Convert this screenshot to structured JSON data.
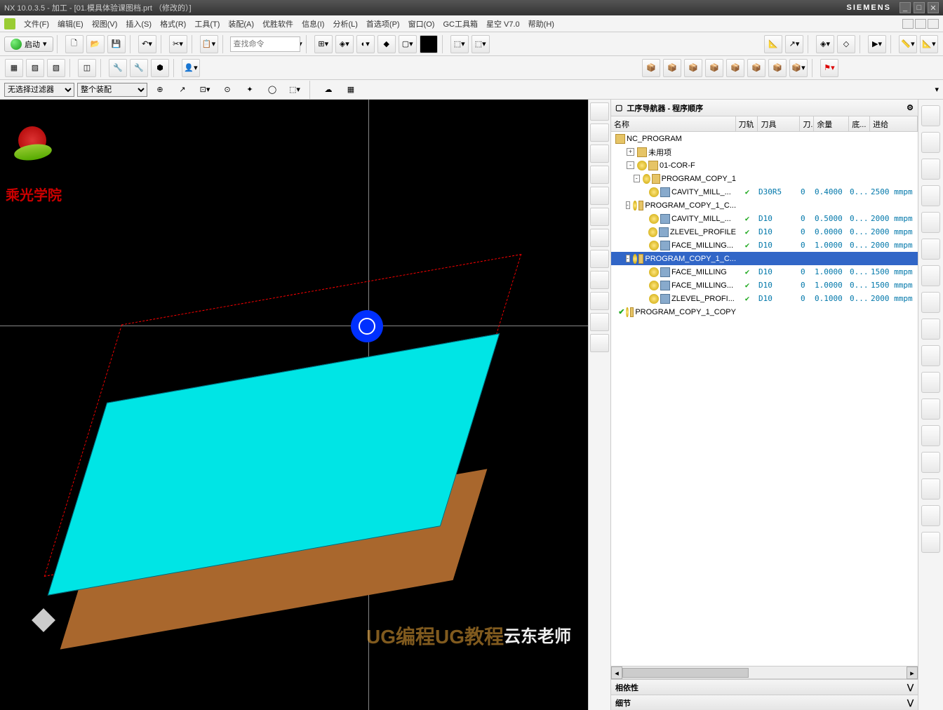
{
  "title": "NX 10.0.3.5 - 加工 - [01.模具体验课图档.prt （修改的）]",
  "brand": "SIEMENS",
  "menus": [
    "文件(F)",
    "编辑(E)",
    "视图(V)",
    "插入(S)",
    "格式(R)",
    "工具(T)",
    "装配(A)",
    "优胜软件",
    "信息(I)",
    "分析(L)",
    "首选项(P)",
    "窗口(O)",
    "GC工具箱",
    "星空 V7.0",
    "帮助(H)"
  ],
  "start": "启动",
  "search_placeholder": "查找命令",
  "filter1": "无选择过滤器",
  "filter2": "整个装配",
  "logo_cn": "乘光学院",
  "watermark1": "云东老师",
  "watermark2": "UG编程UG教程",
  "panel_title": "工序导航器 - 程序顺序",
  "columns": {
    "name": "名称",
    "track": "刀轨",
    "tool": "刀具",
    "knife": "刀...",
    "remain": "余量",
    "bottom": "底...",
    "feed": "进给"
  },
  "footer": {
    "deps": "相依性",
    "detail": "细节"
  },
  "tree": [
    {
      "d": 0,
      "t": "root",
      "label": "NC_PROGRAM"
    },
    {
      "d": 1,
      "t": "folder",
      "exp": "+",
      "label": "未用项"
    },
    {
      "d": 1,
      "t": "folder",
      "exp": "-",
      "bulb": true,
      "label": "01-COR-F"
    },
    {
      "d": 2,
      "t": "folder",
      "exp": "-",
      "bulb": true,
      "label": "PROGRAM_COPY_1"
    },
    {
      "d": 3,
      "t": "op",
      "bulb": true,
      "label": "CAVITY_MILL_...",
      "chk": true,
      "tool": "D30R5",
      "knife": "0",
      "rem": "0.4000",
      "bot": "0...",
      "feed": "2500 mmpm"
    },
    {
      "d": 2,
      "t": "folder",
      "exp": "-",
      "bulb": true,
      "label": "PROGRAM_COPY_1_C..."
    },
    {
      "d": 3,
      "t": "op",
      "bulb": true,
      "label": "CAVITY_MILL_...",
      "chk": true,
      "tool": "D10",
      "knife": "0",
      "rem": "0.5000",
      "bot": "0...",
      "feed": "2000 mmpm"
    },
    {
      "d": 3,
      "t": "op",
      "bulb": true,
      "label": "ZLEVEL_PROFILE",
      "chk": true,
      "tool": "D10",
      "knife": "0",
      "rem": "0.0000",
      "bot": "0...",
      "feed": "2000 mmpm"
    },
    {
      "d": 3,
      "t": "op",
      "bulb": true,
      "label": "FACE_MILLING...",
      "chk": true,
      "tool": "D10",
      "knife": "0",
      "rem": "1.0000",
      "bot": "0...",
      "feed": "2000 mmpm"
    },
    {
      "d": 2,
      "t": "folder",
      "exp": "-",
      "bulb": true,
      "label": "PROGRAM_COPY_1_C...",
      "selected": true
    },
    {
      "d": 3,
      "t": "op",
      "bulb": true,
      "label": "FACE_MILLING",
      "chk": true,
      "tool": "D10",
      "knife": "0",
      "rem": "1.0000",
      "bot": "0...",
      "feed": "1500 mmpm"
    },
    {
      "d": 3,
      "t": "op",
      "bulb": true,
      "label": "FACE_MILLING...",
      "chk": true,
      "tool": "D10",
      "knife": "0",
      "rem": "1.0000",
      "bot": "0...",
      "feed": "1500 mmpm"
    },
    {
      "d": 3,
      "t": "op",
      "bulb": true,
      "label": "ZLEVEL_PROFI...",
      "chk": true,
      "tool": "D10",
      "knife": "0",
      "rem": "0.1000",
      "bot": "0...",
      "feed": "2000 mmpm"
    },
    {
      "d": 1,
      "t": "folder",
      "chk": true,
      "bulb": true,
      "label": "PROGRAM_COPY_1_COPY"
    }
  ]
}
